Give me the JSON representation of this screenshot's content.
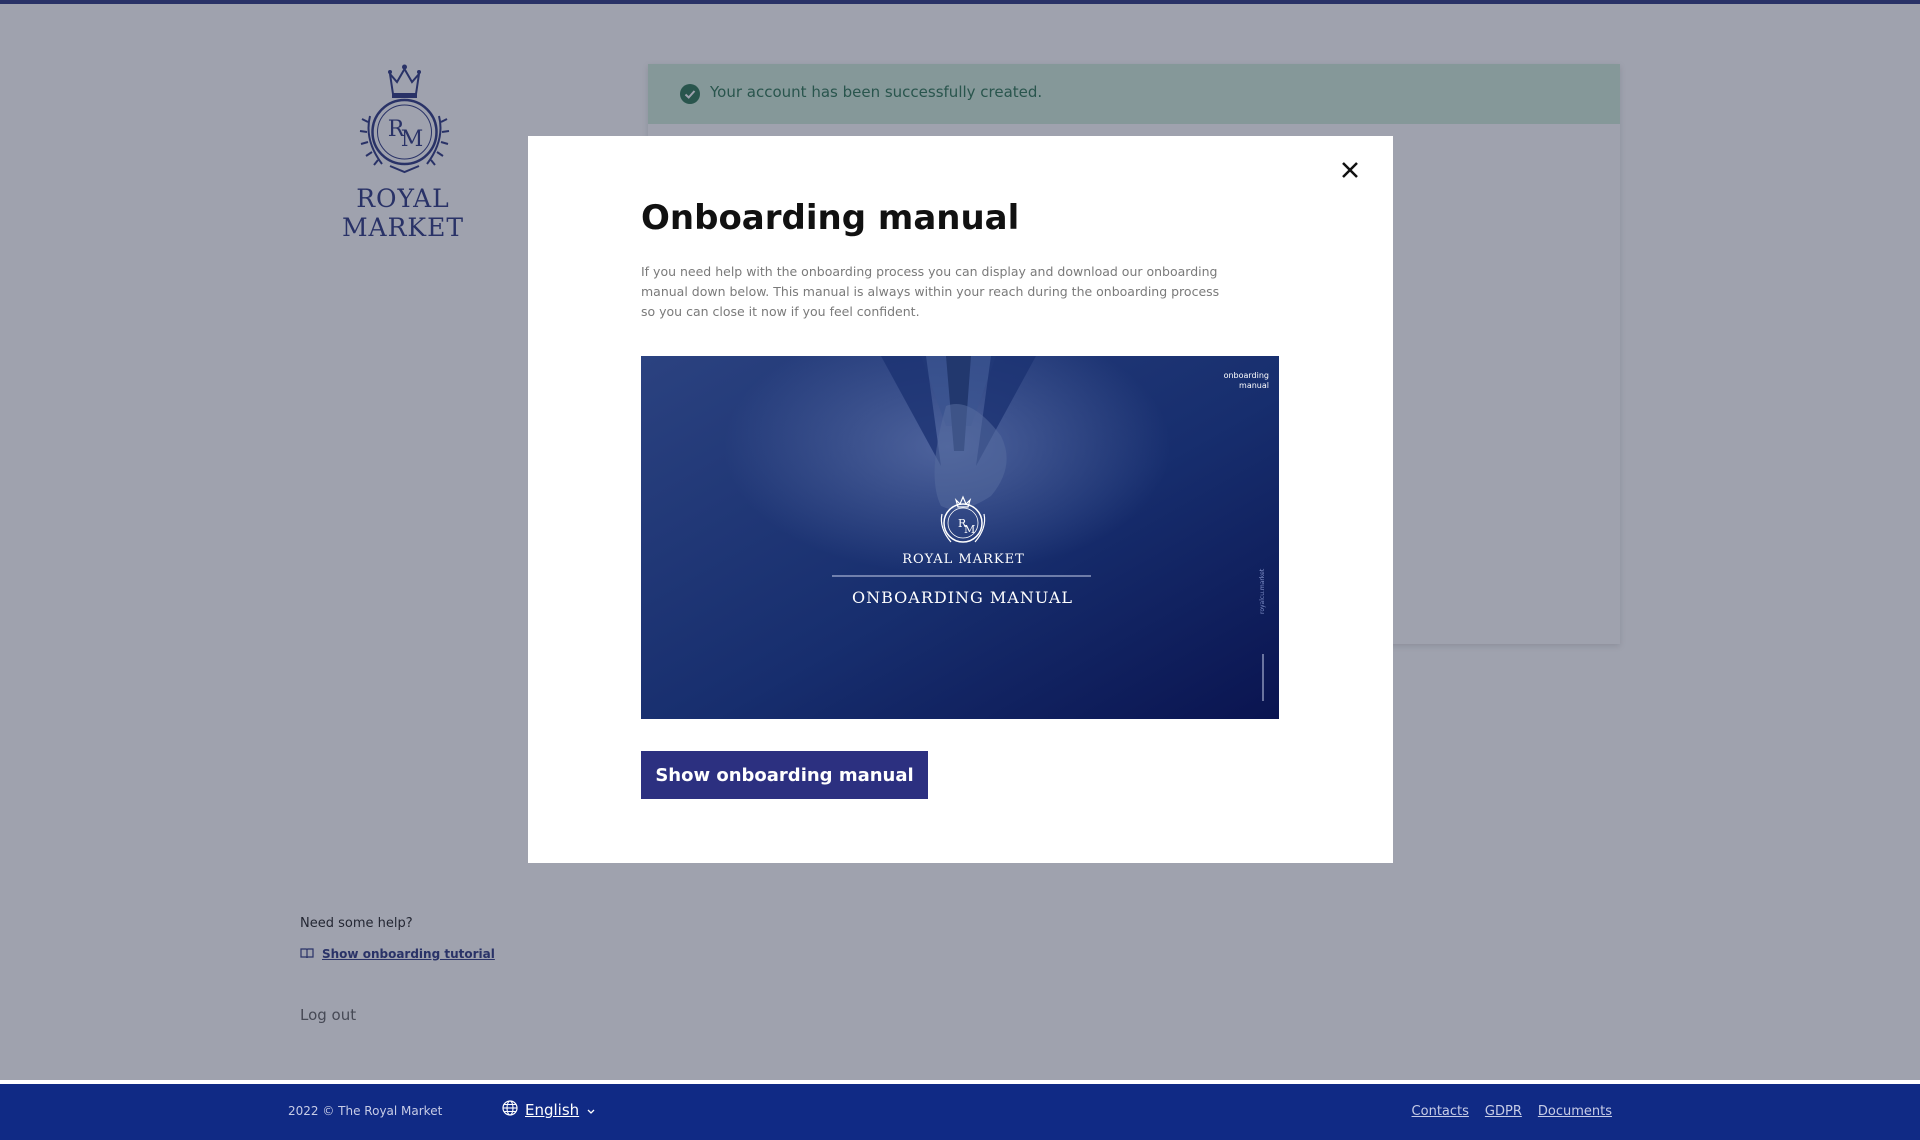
{
  "brand": {
    "name": "ROYAL MARKET",
    "monogram": "RM"
  },
  "alert": {
    "text": "Your account has been successfully created.",
    "icon": "check-circle-icon",
    "color": "#1d6b45"
  },
  "sidebar": {
    "help_title": "Need some help?",
    "tutorial_link": "Show onboarding tutorial",
    "logout": "Log out"
  },
  "modal": {
    "title": "Onboarding manual",
    "description": "If you need help with the onboarding process you can display and download our onboarding manual down below. This manual is always within your reach during the onboarding process so you can close it now if you feel confident.",
    "preview": {
      "corner_line1": "onboarding",
      "corner_line2": "manual",
      "brand": "ROYAL MARKET",
      "title": "ONBOARDING MANUAL",
      "side_text": "royalcu.market"
    },
    "button": "Show onboarding manual"
  },
  "footer": {
    "copyright": "2022 © The Royal Market",
    "language": "English",
    "links": [
      "Contacts",
      "GDPR",
      "Documents"
    ]
  },
  "colors": {
    "brand": "#1e2a78",
    "footer": "#102a85",
    "button": "#2c3080",
    "success_bg": "#cdebd6"
  }
}
